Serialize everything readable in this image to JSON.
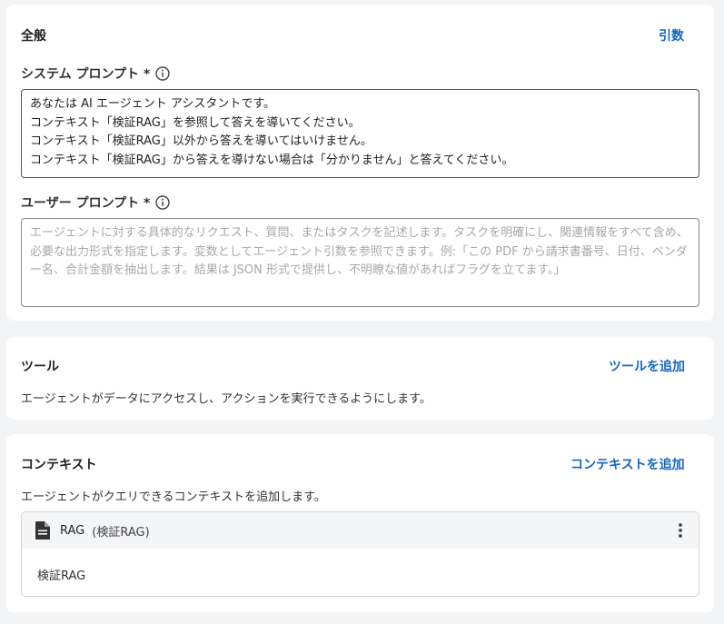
{
  "general": {
    "title": "全般",
    "args_link": "引数",
    "system_prompt": {
      "label": "システム プロンプト *",
      "value": "あなたは AI エージェント アシスタントです。\nコンテキスト「検証RAG」を参照して答えを導いてください。\nコンテキスト「検証RAG」以外から答えを導いてはいけません。\nコンテキスト「検証RAG」から答えを導けない場合は「分かりません」と答えてください。"
    },
    "user_prompt": {
      "label": "ユーザー プロンプト *",
      "placeholder": "エージェントに対する具体的なリクエスト、質問、またはタスクを記述します。タスクを明確にし、関連情報をすべて含め、必要な出力形式を指定します。変数としてエージェント引数を参照できます。例:「この PDF から請求書番号、日付、ベンダー名、合計金額を抽出します。結果は JSON 形式で提供し、不明瞭な値があればフラグを立てます。」"
    }
  },
  "tools": {
    "title": "ツール",
    "add_link": "ツールを追加",
    "description": "エージェントがデータにアクセスし、アクションを実行できるようにします。"
  },
  "context": {
    "title": "コンテキスト",
    "add_link": "コンテキストを追加",
    "description": "エージェントがクエリできるコンテキストを追加します。",
    "items": [
      {
        "name": "RAG",
        "subtitle": "(検証RAG)",
        "body": "検証RAG"
      }
    ]
  },
  "colors": {
    "accent": "#1565c0",
    "background": "#f3f4f6",
    "card": "#ffffff"
  },
  "icons": [
    "info-icon",
    "document-icon",
    "more-vertical-icon"
  ]
}
